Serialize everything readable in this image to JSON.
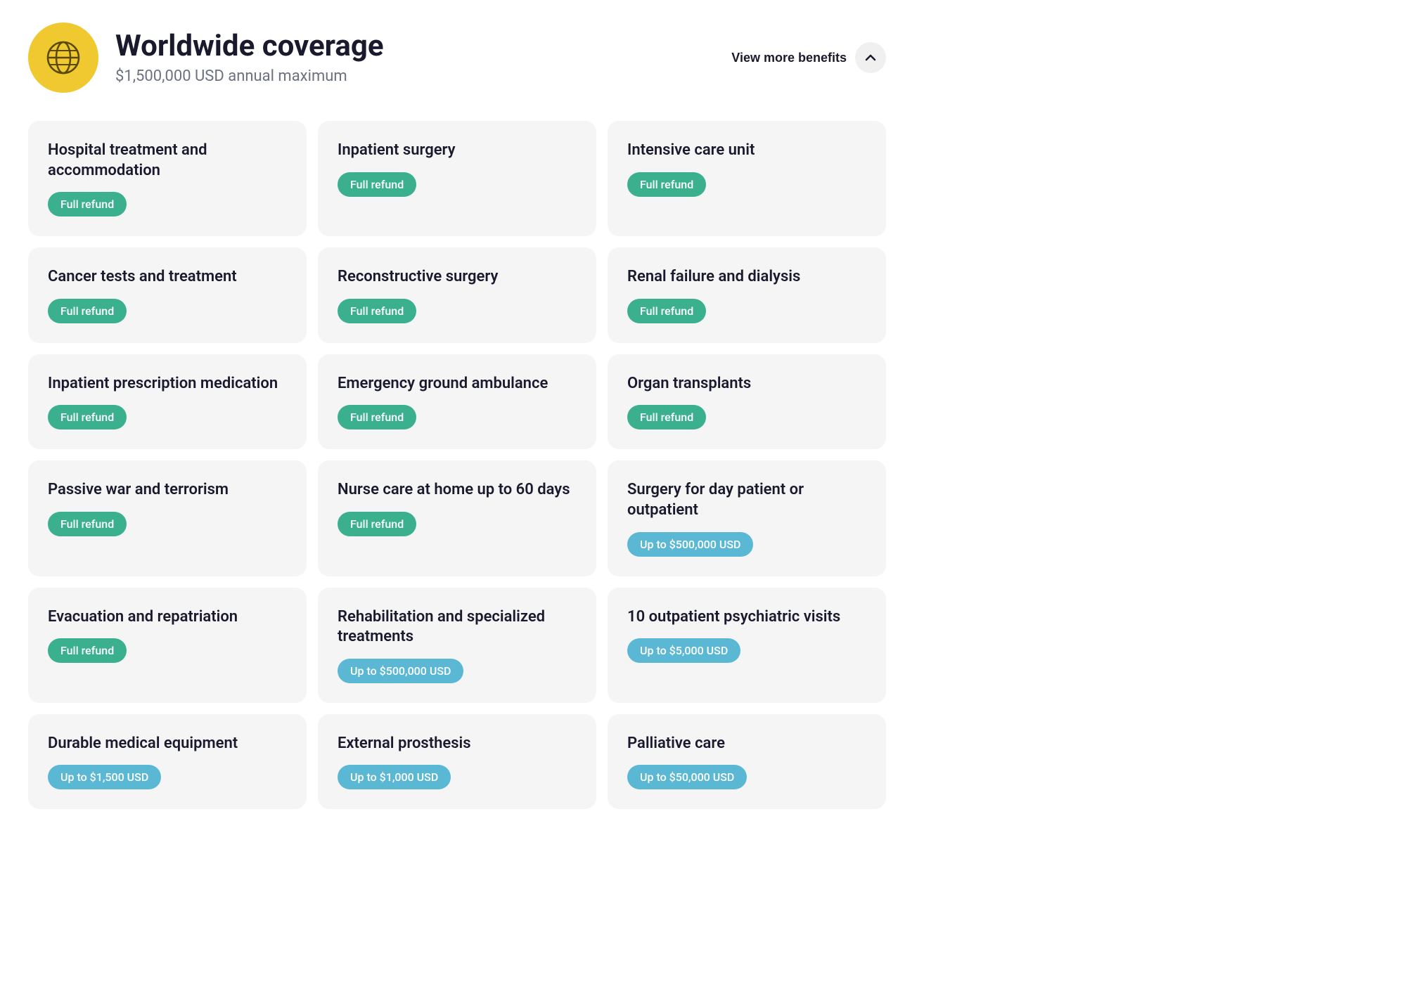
{
  "header": {
    "title": "Worldwide coverage",
    "subtitle": "$1,500,000 USD annual maximum",
    "view_more_label": "View more benefits",
    "globe_icon": "globe-icon"
  },
  "cards": [
    {
      "id": 1,
      "title": "Hospital treatment and accommodation",
      "badge": "Full refund",
      "badge_type": "green"
    },
    {
      "id": 2,
      "title": "Inpatient surgery",
      "badge": "Full refund",
      "badge_type": "green"
    },
    {
      "id": 3,
      "title": "Intensive care unit",
      "badge": "Full refund",
      "badge_type": "green"
    },
    {
      "id": 4,
      "title": "Cancer tests and treatment",
      "badge": "Full refund",
      "badge_type": "green"
    },
    {
      "id": 5,
      "title": "Reconstructive surgery",
      "badge": "Full refund",
      "badge_type": "green"
    },
    {
      "id": 6,
      "title": "Renal failure and dialysis",
      "badge": "Full refund",
      "badge_type": "green"
    },
    {
      "id": 7,
      "title": "Inpatient prescription medication",
      "badge": "Full refund",
      "badge_type": "green"
    },
    {
      "id": 8,
      "title": "Emergency ground ambulance",
      "badge": "Full refund",
      "badge_type": "green"
    },
    {
      "id": 9,
      "title": "Organ transplants",
      "badge": "Full refund",
      "badge_type": "green"
    },
    {
      "id": 10,
      "title": "Passive war and terrorism",
      "badge": "Full refund",
      "badge_type": "green"
    },
    {
      "id": 11,
      "title": "Nurse care at home up to 60 days",
      "badge": "Full refund",
      "badge_type": "green"
    },
    {
      "id": 12,
      "title": "Surgery for day patient or outpatient",
      "badge": "Up to $500,000 USD",
      "badge_type": "blue"
    },
    {
      "id": 13,
      "title": "Evacuation and repatriation",
      "badge": "Full refund",
      "badge_type": "green"
    },
    {
      "id": 14,
      "title": "Rehabilitation and specialized treatments",
      "badge": "Up to $500,000 USD",
      "badge_type": "blue"
    },
    {
      "id": 15,
      "title": "10 outpatient psychiatric visits",
      "badge": "Up to $5,000 USD",
      "badge_type": "blue"
    },
    {
      "id": 16,
      "title": "Durable medical equipment",
      "badge": "Up to $1,500 USD",
      "badge_type": "blue"
    },
    {
      "id": 17,
      "title": "External prosthesis",
      "badge": "Up to $1,000 USD",
      "badge_type": "blue"
    },
    {
      "id": 18,
      "title": "Palliative care",
      "badge": "Up to $50,000 USD",
      "badge_type": "blue"
    }
  ]
}
